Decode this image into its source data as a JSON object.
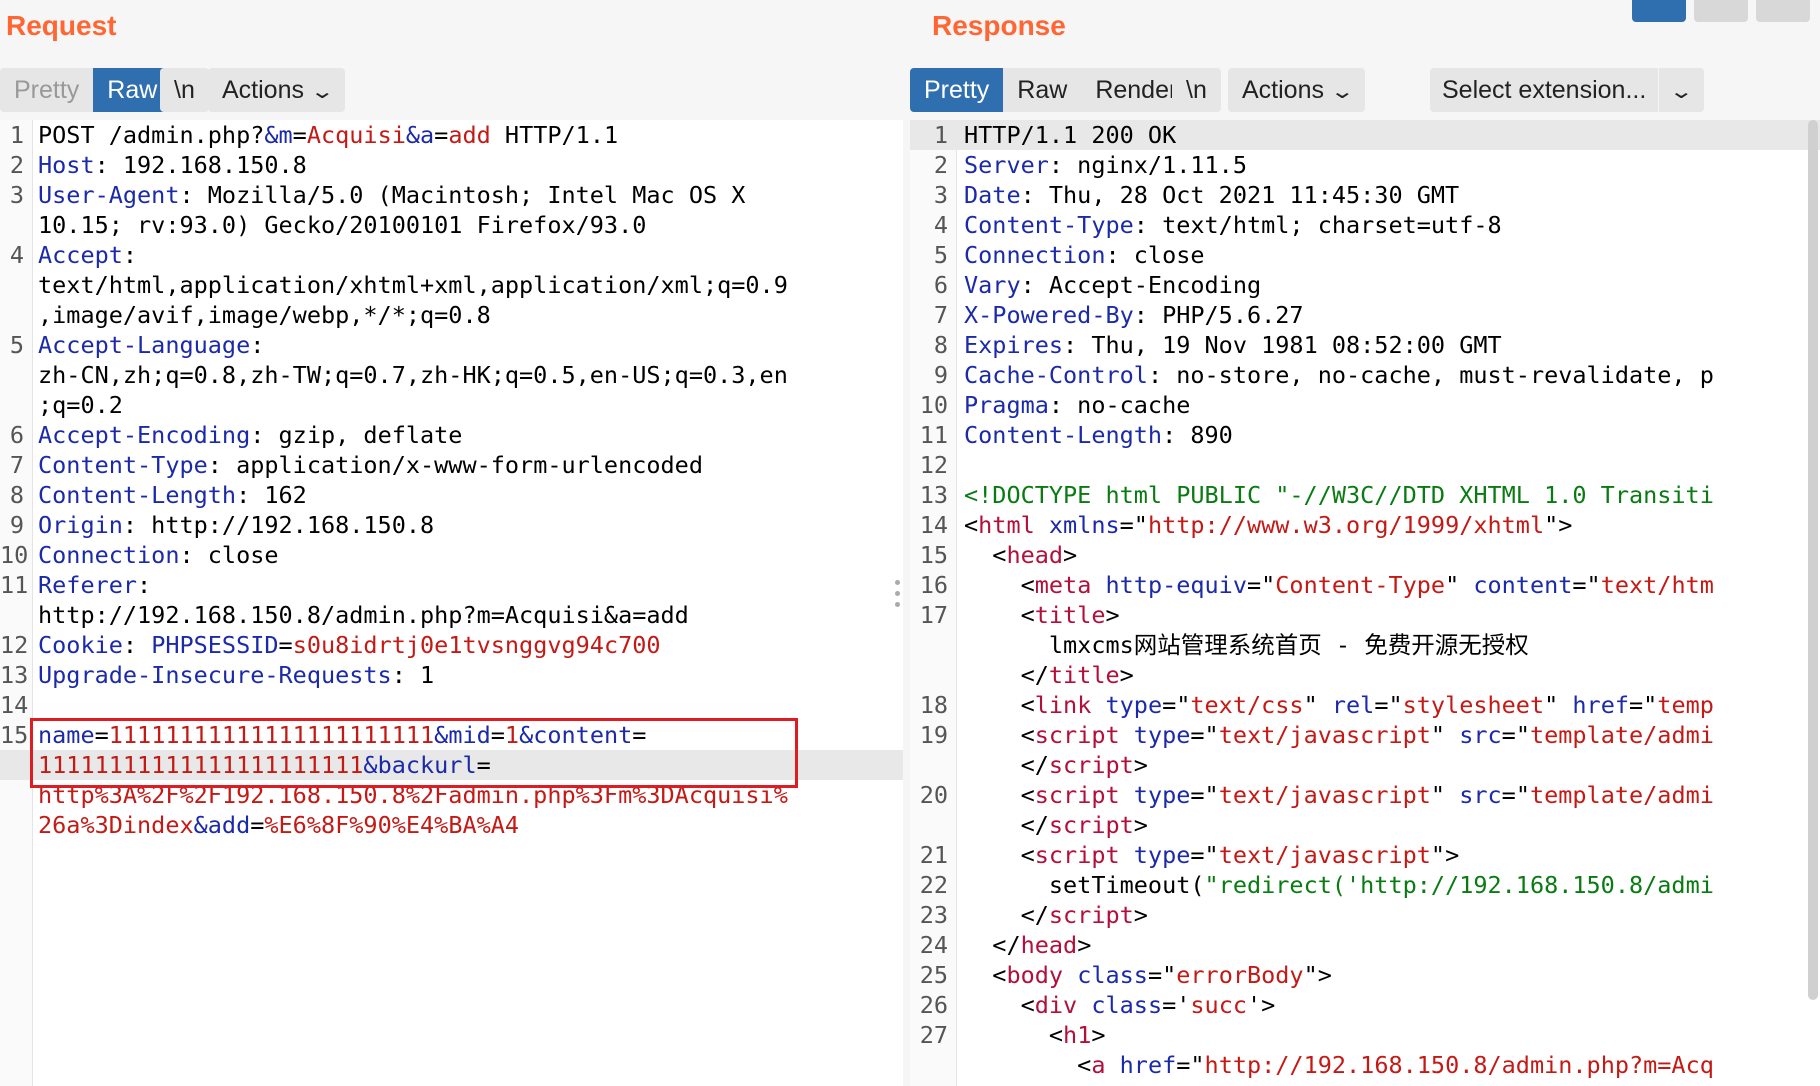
{
  "request": {
    "title": "Request",
    "tabs": {
      "pretty": "Pretty",
      "raw": "Raw",
      "newline": "\\n",
      "actions": "Actions"
    },
    "lines": [
      {
        "n": "1",
        "segs": [
          [
            "txt",
            "POST /admin.php?"
          ],
          [
            "k",
            "&m"
          ],
          [
            "txt",
            "="
          ],
          [
            "v",
            "Acquisi"
          ],
          [
            "k",
            "&a"
          ],
          [
            "txt",
            "="
          ],
          [
            "v",
            "add"
          ],
          [
            "txt",
            " HTTP/1.1"
          ]
        ]
      },
      {
        "n": "2",
        "segs": [
          [
            "k",
            "Host"
          ],
          [
            "txt",
            ": 192.168.150.8"
          ]
        ]
      },
      {
        "n": "3",
        "segs": [
          [
            "k",
            "User-Agent"
          ],
          [
            "txt",
            ": Mozilla/5.0 (Macintosh; Intel Mac OS X"
          ]
        ]
      },
      {
        "n": "",
        "segs": [
          [
            "txt",
            "10.15; rv:93.0) Gecko/20100101 Firefox/93.0"
          ]
        ]
      },
      {
        "n": "4",
        "segs": [
          [
            "k",
            "Accept"
          ],
          [
            "txt",
            ":"
          ]
        ]
      },
      {
        "n": "",
        "segs": [
          [
            "txt",
            "text/html,application/xhtml+xml,application/xml;q=0.9"
          ]
        ]
      },
      {
        "n": "",
        "segs": [
          [
            "txt",
            ",image/avif,image/webp,*/*;q=0.8"
          ]
        ]
      },
      {
        "n": "5",
        "segs": [
          [
            "k",
            "Accept-Language"
          ],
          [
            "txt",
            ":"
          ]
        ]
      },
      {
        "n": "",
        "segs": [
          [
            "txt",
            "zh-CN,zh;q=0.8,zh-TW;q=0.7,zh-HK;q=0.5,en-US;q=0.3,en"
          ]
        ]
      },
      {
        "n": "",
        "segs": [
          [
            "txt",
            ";q=0.2"
          ]
        ]
      },
      {
        "n": "6",
        "segs": [
          [
            "k",
            "Accept-Encoding"
          ],
          [
            "txt",
            ": gzip, deflate"
          ]
        ]
      },
      {
        "n": "7",
        "segs": [
          [
            "k",
            "Content-Type"
          ],
          [
            "txt",
            ": application/x-www-form-urlencoded"
          ]
        ]
      },
      {
        "n": "8",
        "segs": [
          [
            "k",
            "Content-Length"
          ],
          [
            "txt",
            ": 162"
          ]
        ]
      },
      {
        "n": "9",
        "segs": [
          [
            "k",
            "Origin"
          ],
          [
            "txt",
            ": http://192.168.150.8"
          ]
        ]
      },
      {
        "n": "10",
        "segs": [
          [
            "k",
            "Connection"
          ],
          [
            "txt",
            ": close"
          ]
        ]
      },
      {
        "n": "11",
        "segs": [
          [
            "k",
            "Referer"
          ],
          [
            "txt",
            ":"
          ]
        ]
      },
      {
        "n": "",
        "segs": [
          [
            "txt",
            "http://192.168.150.8/admin.php?m=Acquisi&a=add"
          ]
        ]
      },
      {
        "n": "12",
        "segs": [
          [
            "k",
            "Cookie"
          ],
          [
            "txt",
            ": "
          ],
          [
            "k",
            "PHPSESSID"
          ],
          [
            "txt",
            "="
          ],
          [
            "v",
            "s0u8idrtj0e1tvsnggvg94c700"
          ]
        ]
      },
      {
        "n": "13",
        "segs": [
          [
            "k",
            "Upgrade-Insecure-Requests"
          ],
          [
            "txt",
            ": 1"
          ]
        ]
      },
      {
        "n": "14",
        "segs": []
      },
      {
        "n": "15",
        "segs": [
          [
            "k",
            "name"
          ],
          [
            "txt",
            "="
          ],
          [
            "v",
            "11111111111111111111111"
          ],
          [
            "k",
            "&mid"
          ],
          [
            "txt",
            "="
          ],
          [
            "v",
            "1"
          ],
          [
            "k",
            "&content"
          ],
          [
            "txt",
            "="
          ]
        ]
      },
      {
        "n": "",
        "cur": true,
        "segs": [
          [
            "v",
            "11111111111111111111111"
          ],
          [
            "k",
            "&backurl"
          ],
          [
            "txt",
            "="
          ]
        ]
      },
      {
        "n": "",
        "segs": [
          [
            "v",
            "http%3A%2F%2F192.168.150.8%2Fadmin.php%3Fm%3DAcquisi%"
          ]
        ]
      },
      {
        "n": "",
        "segs": [
          [
            "v",
            "26a%3Dindex"
          ],
          [
            "k",
            "&add"
          ],
          [
            "txt",
            "="
          ],
          [
            "v",
            "%E6%8F%90%E4%BA%A4"
          ]
        ]
      }
    ]
  },
  "response": {
    "title": "Response",
    "tabs": {
      "pretty": "Pretty",
      "raw": "Raw",
      "render": "Render",
      "newline": "\\n",
      "actions": "Actions",
      "extension": "Select extension..."
    },
    "lines": [
      {
        "n": "1",
        "cur": true,
        "segs": [
          [
            "txt",
            "HTTP/1.1 200 OK"
          ]
        ]
      },
      {
        "n": "2",
        "segs": [
          [
            "k",
            "Server"
          ],
          [
            "txt",
            ": nginx/1.11.5"
          ]
        ]
      },
      {
        "n": "3",
        "segs": [
          [
            "k",
            "Date"
          ],
          [
            "txt",
            ": Thu, 28 Oct 2021 11:45:30 GMT"
          ]
        ]
      },
      {
        "n": "4",
        "segs": [
          [
            "k",
            "Content-Type"
          ],
          [
            "txt",
            ": text/html; charset=utf-8"
          ]
        ]
      },
      {
        "n": "5",
        "segs": [
          [
            "k",
            "Connection"
          ],
          [
            "txt",
            ": close"
          ]
        ]
      },
      {
        "n": "6",
        "segs": [
          [
            "k",
            "Vary"
          ],
          [
            "txt",
            ": Accept-Encoding"
          ]
        ]
      },
      {
        "n": "7",
        "segs": [
          [
            "k",
            "X-Powered-By"
          ],
          [
            "txt",
            ": PHP/5.6.27"
          ]
        ]
      },
      {
        "n": "8",
        "segs": [
          [
            "k",
            "Expires"
          ],
          [
            "txt",
            ": Thu, 19 Nov 1981 08:52:00 GMT"
          ]
        ]
      },
      {
        "n": "9",
        "segs": [
          [
            "k",
            "Cache-Control"
          ],
          [
            "txt",
            ": no-store, no-cache, must-revalidate, p"
          ]
        ]
      },
      {
        "n": "10",
        "segs": [
          [
            "k",
            "Pragma"
          ],
          [
            "txt",
            ": no-cache"
          ]
        ]
      },
      {
        "n": "11",
        "segs": [
          [
            "k",
            "Content-Length"
          ],
          [
            "txt",
            ": 890"
          ]
        ]
      },
      {
        "n": "12",
        "segs": []
      },
      {
        "n": "13",
        "segs": [
          [
            "s",
            "<!DOCTYPE html PUBLIC \"-//W3C//DTD XHTML 1.0 Transiti"
          ]
        ]
      },
      {
        "n": "14",
        "segs": [
          [
            "txt",
            "<"
          ],
          [
            "t",
            "html"
          ],
          [
            "txt",
            " "
          ],
          [
            "k",
            "xmlns"
          ],
          [
            "txt",
            "=\""
          ],
          [
            "v",
            "http://www.w3.org/1999/xhtml"
          ],
          [
            "txt",
            "\">"
          ]
        ]
      },
      {
        "n": "15",
        "segs": [
          [
            "txt",
            "  <"
          ],
          [
            "t",
            "head"
          ],
          [
            "txt",
            ">"
          ]
        ]
      },
      {
        "n": "16",
        "segs": [
          [
            "txt",
            "    <"
          ],
          [
            "t",
            "meta"
          ],
          [
            "txt",
            " "
          ],
          [
            "k",
            "http-equiv"
          ],
          [
            "txt",
            "=\""
          ],
          [
            "v",
            "Content-Type"
          ],
          [
            "txt",
            "\" "
          ],
          [
            "k",
            "content"
          ],
          [
            "txt",
            "=\""
          ],
          [
            "v",
            "text/htm"
          ]
        ]
      },
      {
        "n": "17",
        "segs": [
          [
            "txt",
            "    <"
          ],
          [
            "t",
            "title"
          ],
          [
            "txt",
            ">"
          ]
        ]
      },
      {
        "n": "",
        "segs": [
          [
            "txt",
            "      lmxcms网站管理系统首页 - 免费开源无授权"
          ]
        ]
      },
      {
        "n": "",
        "segs": [
          [
            "txt",
            "    </"
          ],
          [
            "t",
            "title"
          ],
          [
            "txt",
            ">"
          ]
        ]
      },
      {
        "n": "18",
        "segs": [
          [
            "txt",
            "    <"
          ],
          [
            "t",
            "link"
          ],
          [
            "txt",
            " "
          ],
          [
            "k",
            "type"
          ],
          [
            "txt",
            "=\""
          ],
          [
            "v",
            "text/css"
          ],
          [
            "txt",
            "\" "
          ],
          [
            "k",
            "rel"
          ],
          [
            "txt",
            "=\""
          ],
          [
            "v",
            "stylesheet"
          ],
          [
            "txt",
            "\" "
          ],
          [
            "k",
            "href"
          ],
          [
            "txt",
            "=\""
          ],
          [
            "v",
            "temp"
          ]
        ]
      },
      {
        "n": "19",
        "segs": [
          [
            "txt",
            "    <"
          ],
          [
            "t",
            "script"
          ],
          [
            "txt",
            " "
          ],
          [
            "k",
            "type"
          ],
          [
            "txt",
            "=\""
          ],
          [
            "v",
            "text/javascript"
          ],
          [
            "txt",
            "\" "
          ],
          [
            "k",
            "src"
          ],
          [
            "txt",
            "=\""
          ],
          [
            "v",
            "template/admi"
          ]
        ]
      },
      {
        "n": "",
        "segs": [
          [
            "txt",
            "    </"
          ],
          [
            "t",
            "script"
          ],
          [
            "txt",
            ">"
          ]
        ]
      },
      {
        "n": "20",
        "segs": [
          [
            "txt",
            "    <"
          ],
          [
            "t",
            "script"
          ],
          [
            "txt",
            " "
          ],
          [
            "k",
            "type"
          ],
          [
            "txt",
            "=\""
          ],
          [
            "v",
            "text/javascript"
          ],
          [
            "txt",
            "\" "
          ],
          [
            "k",
            "src"
          ],
          [
            "txt",
            "=\""
          ],
          [
            "v",
            "template/admi"
          ]
        ]
      },
      {
        "n": "",
        "segs": [
          [
            "txt",
            "    </"
          ],
          [
            "t",
            "script"
          ],
          [
            "txt",
            ">"
          ]
        ]
      },
      {
        "n": "21",
        "segs": [
          [
            "txt",
            "    <"
          ],
          [
            "t",
            "script"
          ],
          [
            "txt",
            " "
          ],
          [
            "k",
            "type"
          ],
          [
            "txt",
            "=\""
          ],
          [
            "v",
            "text/javascript"
          ],
          [
            "txt",
            "\">"
          ]
        ]
      },
      {
        "n": "22",
        "segs": [
          [
            "txt",
            "      setTimeout("
          ],
          [
            "s",
            "\"redirect('http://192.168.150.8/admi"
          ]
        ]
      },
      {
        "n": "23",
        "segs": [
          [
            "txt",
            "    </"
          ],
          [
            "t",
            "script"
          ],
          [
            "txt",
            ">"
          ]
        ]
      },
      {
        "n": "24",
        "segs": [
          [
            "txt",
            "  </"
          ],
          [
            "t",
            "head"
          ],
          [
            "txt",
            ">"
          ]
        ]
      },
      {
        "n": "25",
        "segs": [
          [
            "txt",
            "  <"
          ],
          [
            "t",
            "body"
          ],
          [
            "txt",
            " "
          ],
          [
            "k",
            "class"
          ],
          [
            "txt",
            "=\""
          ],
          [
            "v",
            "errorBody"
          ],
          [
            "txt",
            "\">"
          ]
        ]
      },
      {
        "n": "26",
        "segs": [
          [
            "txt",
            "    <"
          ],
          [
            "t",
            "div"
          ],
          [
            "txt",
            " "
          ],
          [
            "k",
            "class"
          ],
          [
            "txt",
            "='"
          ],
          [
            "v",
            "succ"
          ],
          [
            "txt",
            "'>"
          ]
        ]
      },
      {
        "n": "27",
        "segs": [
          [
            "txt",
            "      <"
          ],
          [
            "t",
            "h1"
          ],
          [
            "txt",
            ">"
          ]
        ]
      },
      {
        "n": "",
        "segs": [
          [
            "txt",
            "        <"
          ],
          [
            "t",
            "a"
          ],
          [
            "txt",
            " "
          ],
          [
            "k",
            "href"
          ],
          [
            "txt",
            "=\""
          ],
          [
            "v",
            "http://192.168.150.8/admin.php?m=Acq"
          ]
        ]
      }
    ]
  }
}
